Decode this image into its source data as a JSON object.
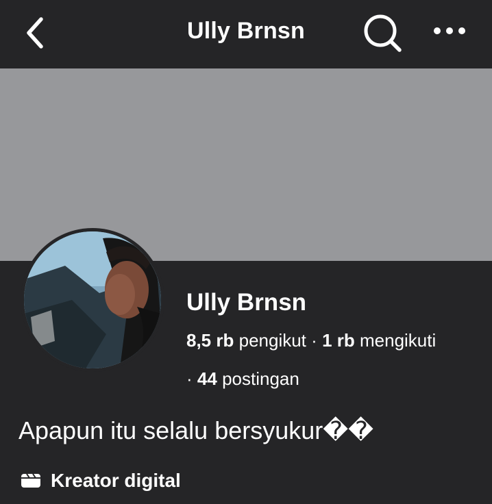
{
  "header": {
    "back_icon": "chevron-left-icon",
    "title": "Ully Brnsn",
    "search_icon": "search-icon",
    "more_icon": "more-horizontal-icon"
  },
  "profile": {
    "name": "Ully Brnsn",
    "followers_count": "8,5 rb",
    "followers_label": "pengikut",
    "separator": "·",
    "following_count": "1 rb",
    "following_label": "mengikuti",
    "posts_count": "44",
    "posts_label": "postingan",
    "bio": "Apapun itu selalu bersyukur��",
    "category_icon": "clapperboard-icon",
    "category": "Kreator digital"
  },
  "colors": {
    "background": "#252527",
    "cover": "#97989b",
    "text": "#ffffff"
  }
}
